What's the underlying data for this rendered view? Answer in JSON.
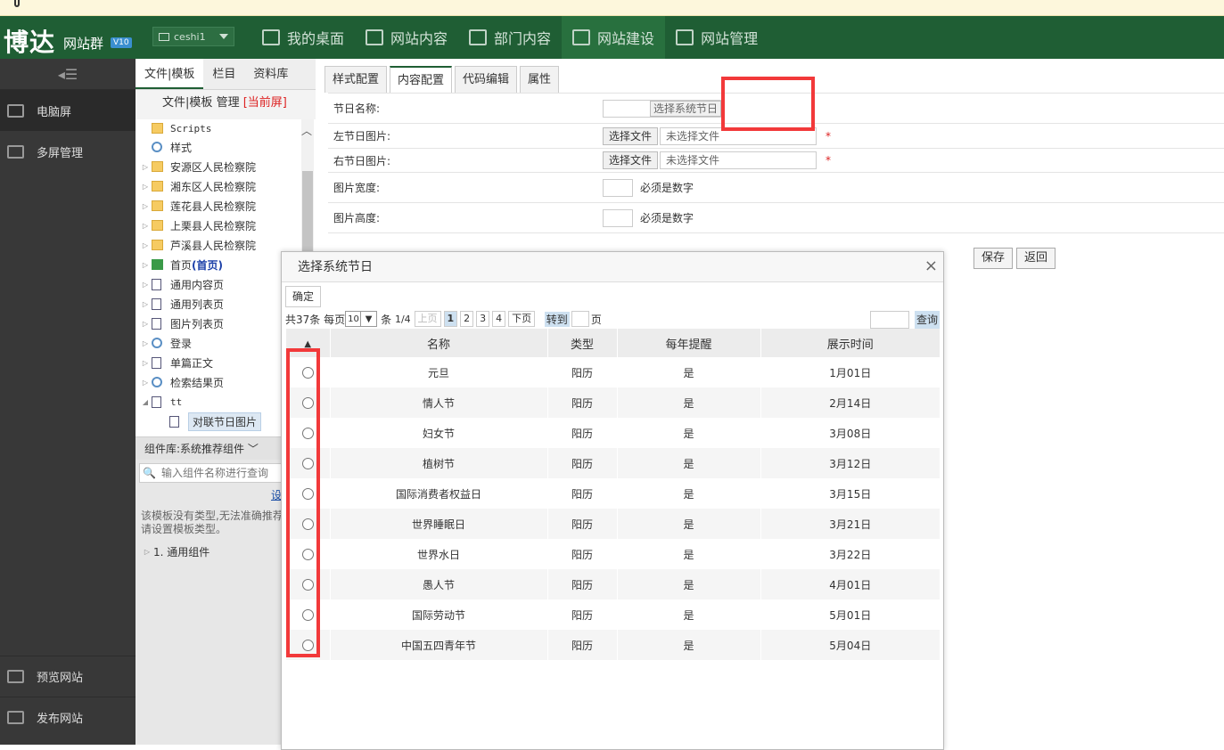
{
  "brand": {
    "name": "博达",
    "sub": "网站群",
    "version": "V10"
  },
  "user_select": {
    "value": "ceshi1"
  },
  "nav": [
    {
      "label": "我的桌面"
    },
    {
      "label": "网站内容"
    },
    {
      "label": "部门内容"
    },
    {
      "label": "网站建设"
    },
    {
      "label": "网站管理"
    }
  ],
  "leftbar": {
    "top_items": [
      {
        "label": "电脑屏"
      },
      {
        "label": "多屏管理"
      }
    ],
    "bottom_items": [
      {
        "label": "预览网站"
      },
      {
        "label": "发布网站"
      }
    ]
  },
  "panel": {
    "tabs": [
      "文件|模板",
      "栏目",
      "资料库"
    ],
    "subbar": {
      "file": "文件",
      "template": "模板",
      "manage": "管理",
      "current": "[当前屏]"
    },
    "tree": [
      {
        "label": "Scripts",
        "icon": "folder",
        "mono": true,
        "arrow": ""
      },
      {
        "label": "样式",
        "icon": "gear",
        "arrow": ""
      },
      {
        "label": "安源区人民检察院",
        "icon": "folder",
        "arrow": "▷"
      },
      {
        "label": "湘东区人民检察院",
        "icon": "folder",
        "arrow": "▷"
      },
      {
        "label": "莲花县人民检察院",
        "icon": "folder",
        "arrow": "▷"
      },
      {
        "label": "上栗县人民检察院",
        "icon": "folder",
        "arrow": "▷"
      },
      {
        "label": "芦溪县人民检察院",
        "icon": "folder",
        "arrow": "▷"
      },
      {
        "label": "首页",
        "label2": "(首页)",
        "icon": "home",
        "arrow": "▷"
      },
      {
        "label": "通用内容页",
        "icon": "page",
        "arrow": "▷"
      },
      {
        "label": "通用列表页",
        "icon": "page",
        "arrow": "▷"
      },
      {
        "label": "图片列表页",
        "icon": "page",
        "arrow": "▷"
      },
      {
        "label": "登录",
        "icon": "gear",
        "arrow": "▷"
      },
      {
        "label": "单篇正文",
        "icon": "page",
        "arrow": "▷"
      },
      {
        "label": "检索结果页",
        "icon": "gear",
        "arrow": "▷"
      },
      {
        "label": "tt",
        "icon": "page",
        "mono": true,
        "arrow": "◢"
      },
      {
        "label": "对联节日图片",
        "icon": "page",
        "indent": true,
        "selected": true,
        "arrow": ""
      }
    ],
    "component_library": {
      "label": "组件库:",
      "value": "系统推荐组件"
    },
    "component_search_placeholder": "输入组件名称进行查询",
    "set_link": "设置模板",
    "tip": "该模板没有类型,无法准确推荐组件,请设置模板类型。",
    "component_group": "1. 通用组件"
  },
  "main": {
    "tabs": [
      "样式配置",
      "内容配置",
      "代码编辑",
      "属性"
    ],
    "active_tab": 1,
    "form": {
      "festival_name": {
        "label": "节日名称:",
        "button": "选择系统节日"
      },
      "left_image": {
        "label": "左节日图片:",
        "button": "选择文件",
        "placeholder": "未选择文件"
      },
      "right_image": {
        "label": "右节日图片:",
        "button": "选择文件",
        "placeholder": "未选择文件"
      },
      "width": {
        "label": "图片宽度:",
        "hint": "必须是数字"
      },
      "height": {
        "label": "图片高度:",
        "hint": "必须是数字"
      },
      "required_mark": "*"
    },
    "actions": {
      "save": "保存",
      "back": "返回"
    }
  },
  "modal": {
    "title": "选择系统节日",
    "close": "×",
    "confirm": "确定",
    "pager": {
      "total": "共37条",
      "per_page_label": "每页",
      "per_page": "10",
      "unit": "条",
      "page_info": "1/4",
      "prev": "上页",
      "pages": [
        "1",
        "2",
        "3",
        "4"
      ],
      "next": "下页",
      "goto": "转到",
      "page_unit": "页",
      "search": "查询"
    },
    "columns": [
      "名称",
      "类型",
      "每年提醒",
      "展示时间"
    ],
    "sort_icon": "▲",
    "rows": [
      {
        "name": "元旦",
        "type": "阳历",
        "remind": "是",
        "date": "1月01日"
      },
      {
        "name": "情人节",
        "type": "阳历",
        "remind": "是",
        "date": "2月14日"
      },
      {
        "name": "妇女节",
        "type": "阳历",
        "remind": "是",
        "date": "3月08日"
      },
      {
        "name": "植树节",
        "type": "阳历",
        "remind": "是",
        "date": "3月12日"
      },
      {
        "name": "国际消费者权益日",
        "type": "阳历",
        "remind": "是",
        "date": "3月15日"
      },
      {
        "name": "世界睡眠日",
        "type": "阳历",
        "remind": "是",
        "date": "3月21日"
      },
      {
        "name": "世界水日",
        "type": "阳历",
        "remind": "是",
        "date": "3月22日"
      },
      {
        "name": "愚人节",
        "type": "阳历",
        "remind": "是",
        "date": "4月01日"
      },
      {
        "name": "国际劳动节",
        "type": "阳历",
        "remind": "是",
        "date": "5月01日"
      },
      {
        "name": "中国五四青年节",
        "type": "阳历",
        "remind": "是",
        "date": "5月04日"
      }
    ]
  },
  "colors": {
    "header": "#1f5e34",
    "sidebar": "#383838",
    "highlight_box": "#f2393a"
  }
}
